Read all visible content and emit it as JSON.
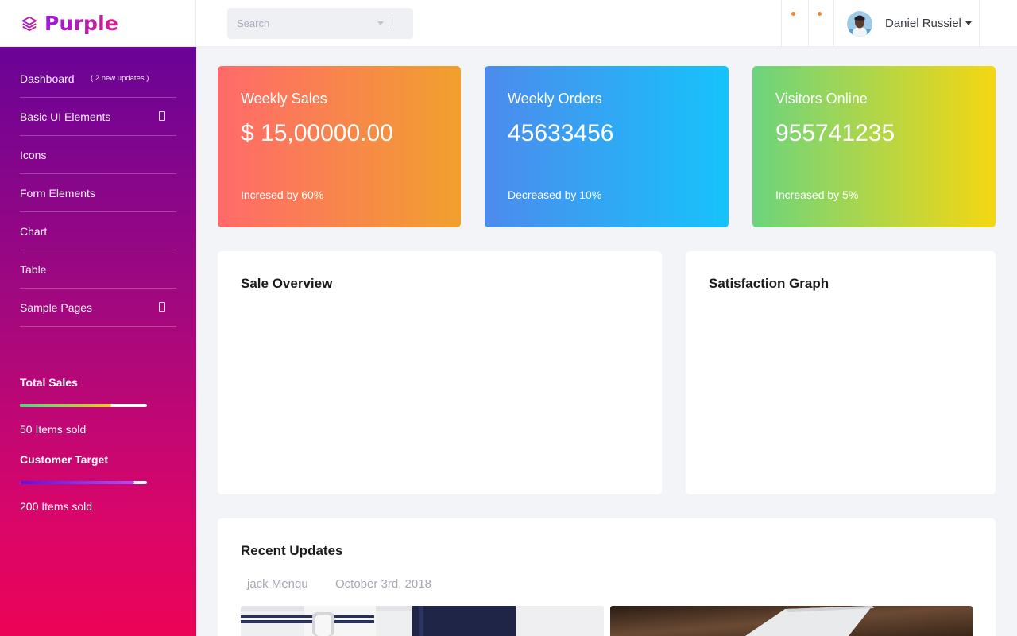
{
  "brand": {
    "name": "Purple"
  },
  "search": {
    "placeholder": "Search"
  },
  "user": {
    "name": "Daniel Russiel"
  },
  "sidebar": {
    "items": [
      {
        "label": "Dashboard",
        "badge": "( 2 new updates )"
      },
      {
        "label": "Basic UI Elements"
      },
      {
        "label": "Icons"
      },
      {
        "label": "Form Elements"
      },
      {
        "label": "Chart"
      },
      {
        "label": "Table"
      },
      {
        "label": "Sample Pages"
      }
    ],
    "total_sales": {
      "title": "Total Sales",
      "text": "50 Items sold"
    },
    "customer_target": {
      "title": "Customer Target",
      "text": "200 Items sold"
    }
  },
  "cards": [
    {
      "title": "Weekly Sales",
      "value": "$ 15,00000.00",
      "sub": "Incresed by 60%"
    },
    {
      "title": "Weekly Orders",
      "value": "45633456",
      "sub": "Decreased by 10%"
    },
    {
      "title": "Visitors Online",
      "value": "955741235",
      "sub": "Increased by 5%"
    }
  ],
  "panels": {
    "sale_overview": "Sale Overview",
    "satisfaction": "Satisfaction Graph",
    "recent_updates": {
      "title": "Recent Updates",
      "author": "jack Menqu",
      "date": "October 3rd, 2018"
    }
  },
  "colors": {
    "card_sales": [
      "#ff6a6a",
      "#f1a02e"
    ],
    "card_orders": [
      "#4d8bec",
      "#16c3fb"
    ],
    "card_visitors": [
      "#6cd47e",
      "#f5d712"
    ],
    "sidebar": [
      "#6a0397",
      "#ec0357"
    ]
  }
}
